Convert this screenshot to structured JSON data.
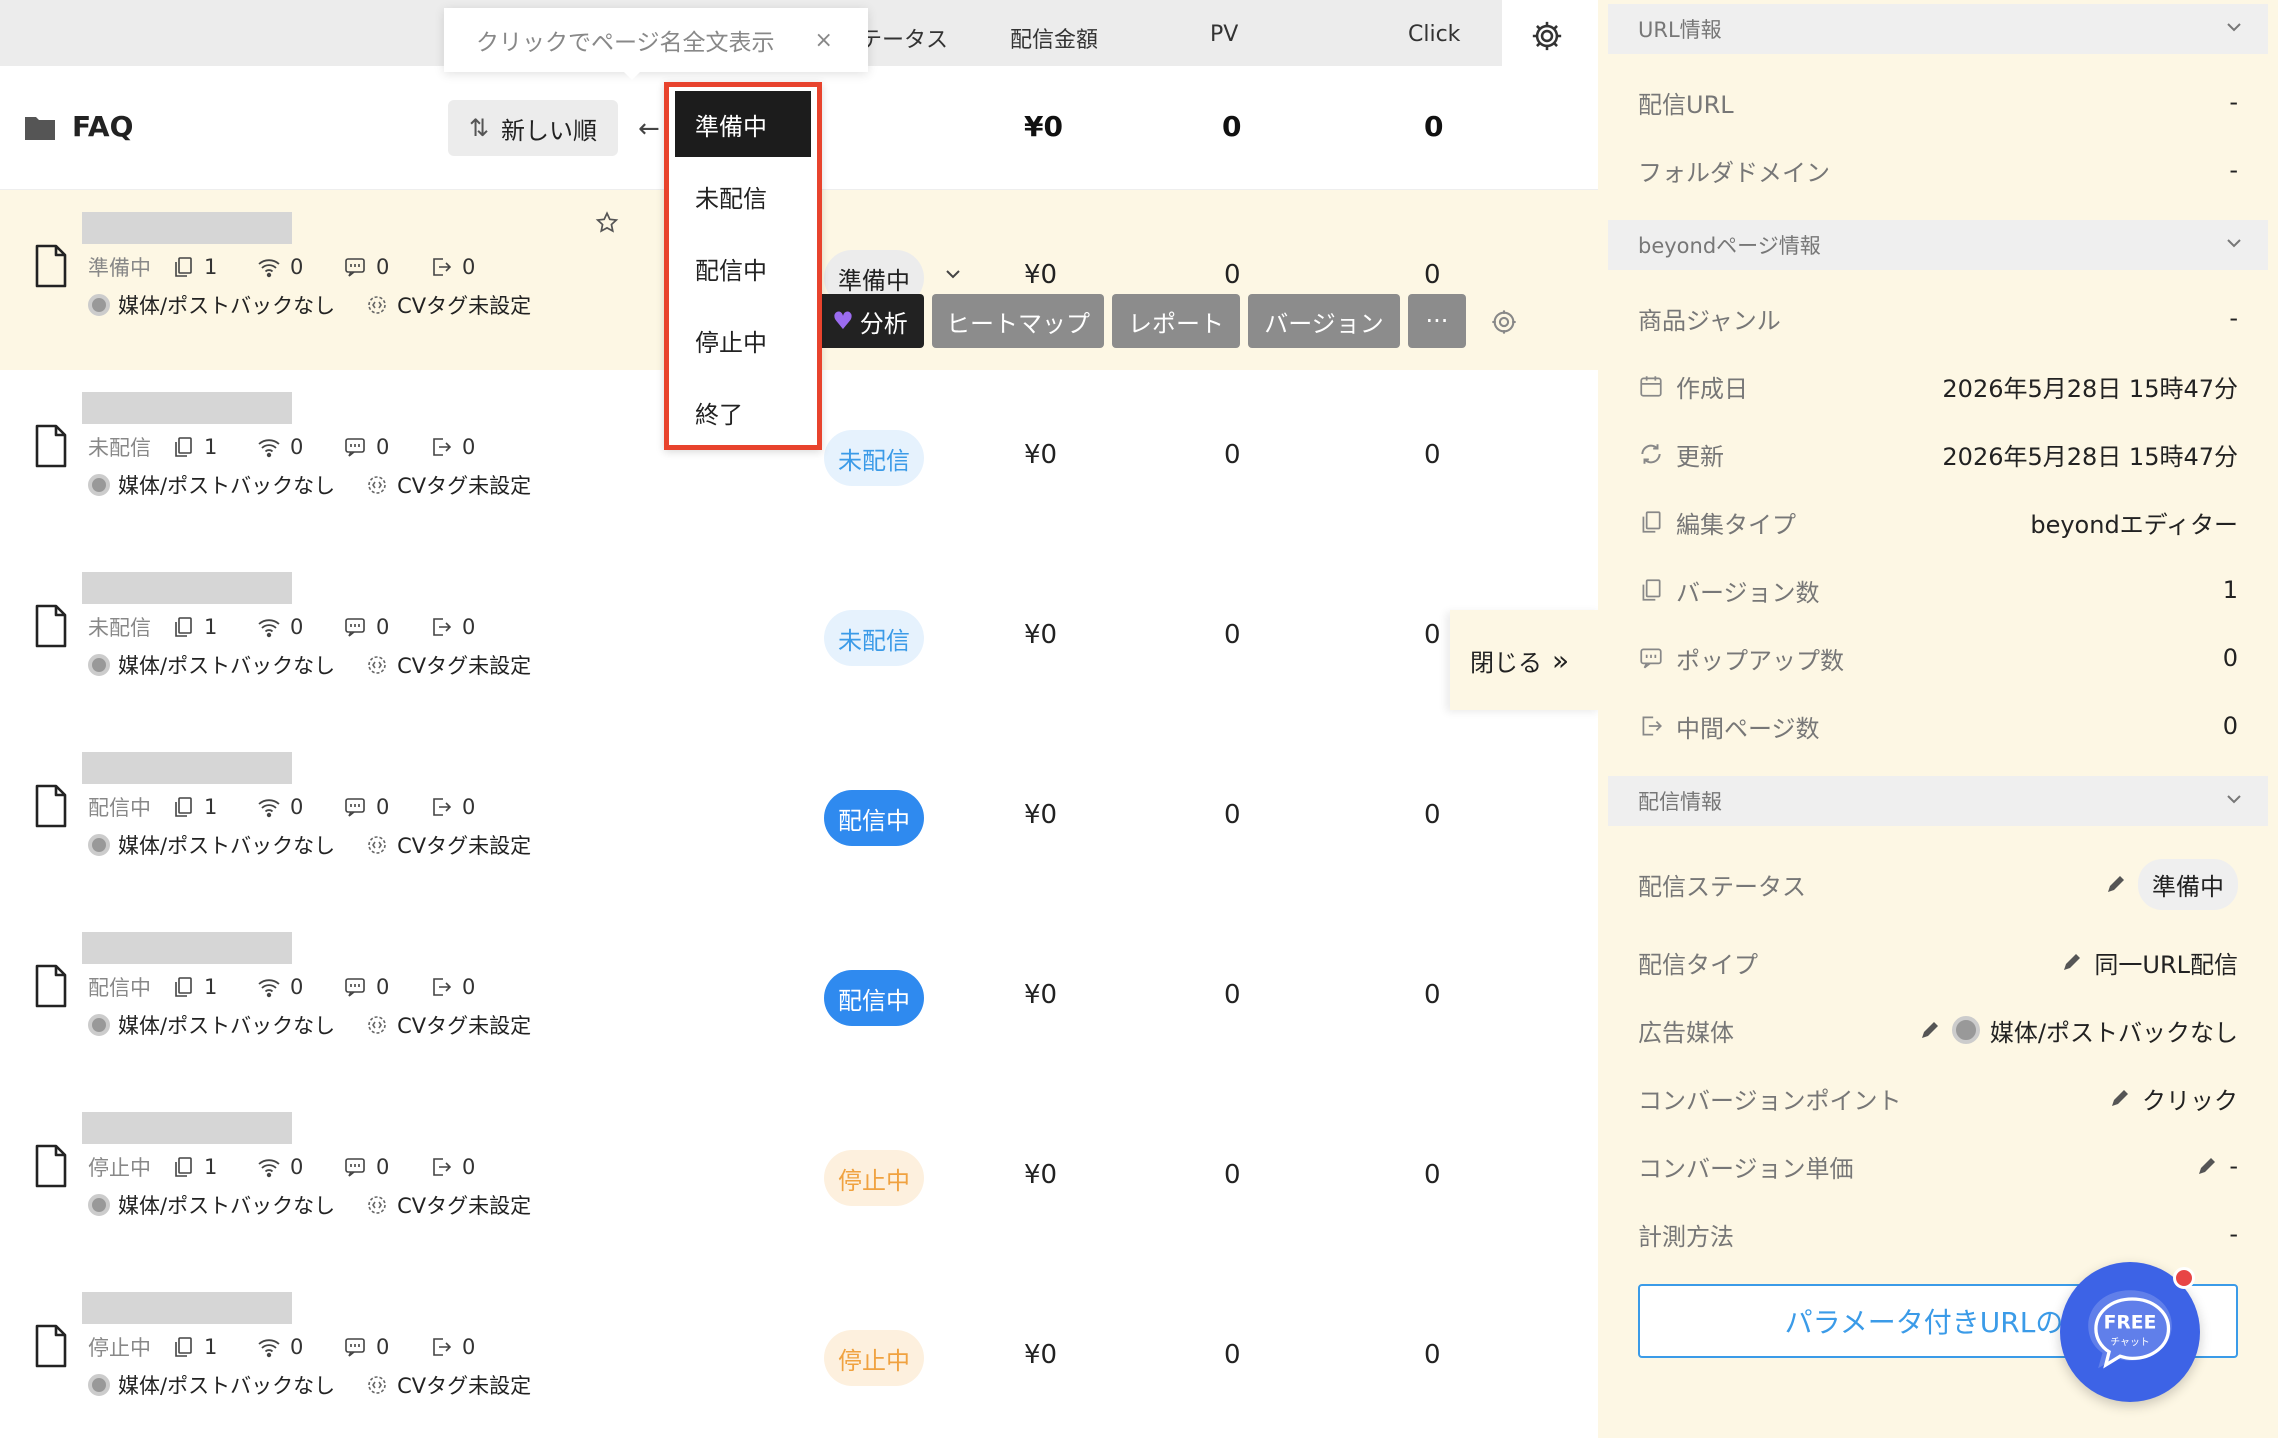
{
  "header": {
    "status_col": "テータス",
    "amount_col": "配信金額",
    "pv_col": "PV",
    "click_col": "Click"
  },
  "tooltip": {
    "text": "クリックでページ名全文表示",
    "close": "×"
  },
  "folder": {
    "name": "FAQ",
    "sort_label": "新しい順",
    "amount": "¥0",
    "pv": "0",
    "click": "0"
  },
  "dropdown": [
    "準備中",
    "未配信",
    "配信中",
    "停止中",
    "終了"
  ],
  "rows": [
    {
      "status_small": "準備中",
      "versions": "1",
      "signal": "0",
      "popups": "0",
      "exits": "0",
      "media": "媒体/ポストバックなし",
      "cv": "CVタグ未設定",
      "badge": "準備中",
      "amount": "¥0",
      "pv": "0",
      "click": "0"
    },
    {
      "status_small": "未配信",
      "versions": "1",
      "signal": "0",
      "popups": "0",
      "exits": "0",
      "media": "媒体/ポストバックなし",
      "cv": "CVタグ未設定",
      "badge": "未配信",
      "amount": "¥0",
      "pv": "0",
      "click": "0"
    },
    {
      "status_small": "未配信",
      "versions": "1",
      "signal": "0",
      "popups": "0",
      "exits": "0",
      "media": "媒体/ポストバックなし",
      "cv": "CVタグ未設定",
      "badge": "未配信",
      "amount": "¥0",
      "pv": "0",
      "click": "0"
    },
    {
      "status_small": "配信中",
      "versions": "1",
      "signal": "0",
      "popups": "0",
      "exits": "0",
      "media": "媒体/ポストバックなし",
      "cv": "CVタグ未設定",
      "badge": "配信中",
      "amount": "¥0",
      "pv": "0",
      "click": "0"
    },
    {
      "status_small": "配信中",
      "versions": "1",
      "signal": "0",
      "popups": "0",
      "exits": "0",
      "media": "媒体/ポストバックなし",
      "cv": "CVタグ未設定",
      "badge": "配信中",
      "amount": "¥0",
      "pv": "0",
      "click": "0"
    },
    {
      "status_small": "停止中",
      "versions": "1",
      "signal": "0",
      "popups": "0",
      "exits": "0",
      "media": "媒体/ポストバックなし",
      "cv": "CVタグ未設定",
      "badge": "停止中",
      "amount": "¥0",
      "pv": "0",
      "click": "0"
    },
    {
      "status_small": "停止中",
      "versions": "1",
      "signal": "0",
      "popups": "0",
      "exits": "0",
      "media": "媒体/ポストバックなし",
      "cv": "CVタグ未設定",
      "badge": "停止中",
      "amount": "¥0",
      "pv": "0",
      "click": "0"
    }
  ],
  "actions": {
    "analyze": "分析",
    "heatmap": "ヒートマップ",
    "report": "レポート",
    "version": "バージョン",
    "more": "···"
  },
  "close_tab": "閉じる",
  "panel": {
    "url_section": "URL情報",
    "delivery_url_label": "配信URL",
    "delivery_url_value": "-",
    "folder_domain_label": "フォルダドメイン",
    "folder_domain_value": "-",
    "beyond_section": "beyondページ情報",
    "genre_label": "商品ジャンル",
    "genre_value": "-",
    "created_label": "作成日",
    "created_value": "2026年5月28日 15時47分",
    "updated_label": "更新",
    "updated_value": "2026年5月28日 15時47分",
    "edit_type_label": "編集タイプ",
    "edit_type_value": "beyondエディター",
    "version_count_label": "バージョン数",
    "version_count_value": "1",
    "popup_count_label": "ポップアップ数",
    "popup_count_value": "0",
    "mid_page_label": "中間ページ数",
    "mid_page_value": "0",
    "delivery_section": "配信情報",
    "delivery_status_label": "配信ステータス",
    "delivery_status_value": "準備中",
    "delivery_type_label": "配信タイプ",
    "delivery_type_value": "同一URL配信",
    "ad_media_label": "広告媒体",
    "ad_media_value": "媒体/ポストバックなし",
    "conversion_point_label": "コンバージョンポイント",
    "conversion_point_value": "クリック",
    "conversion_price_label": "コンバージョン単価",
    "conversion_price_value": "-",
    "measure_label": "計測方法",
    "measure_value": "-",
    "param_url_button": "パラメータ付きURLの発"
  },
  "chat": {
    "free": "FREE",
    "sub": "チャット"
  },
  "colors": {
    "accent": "#2f8aef",
    "highlight_border": "#e8432d",
    "panel_bg": "#fdf7e4",
    "chat": "#3d63e6"
  }
}
